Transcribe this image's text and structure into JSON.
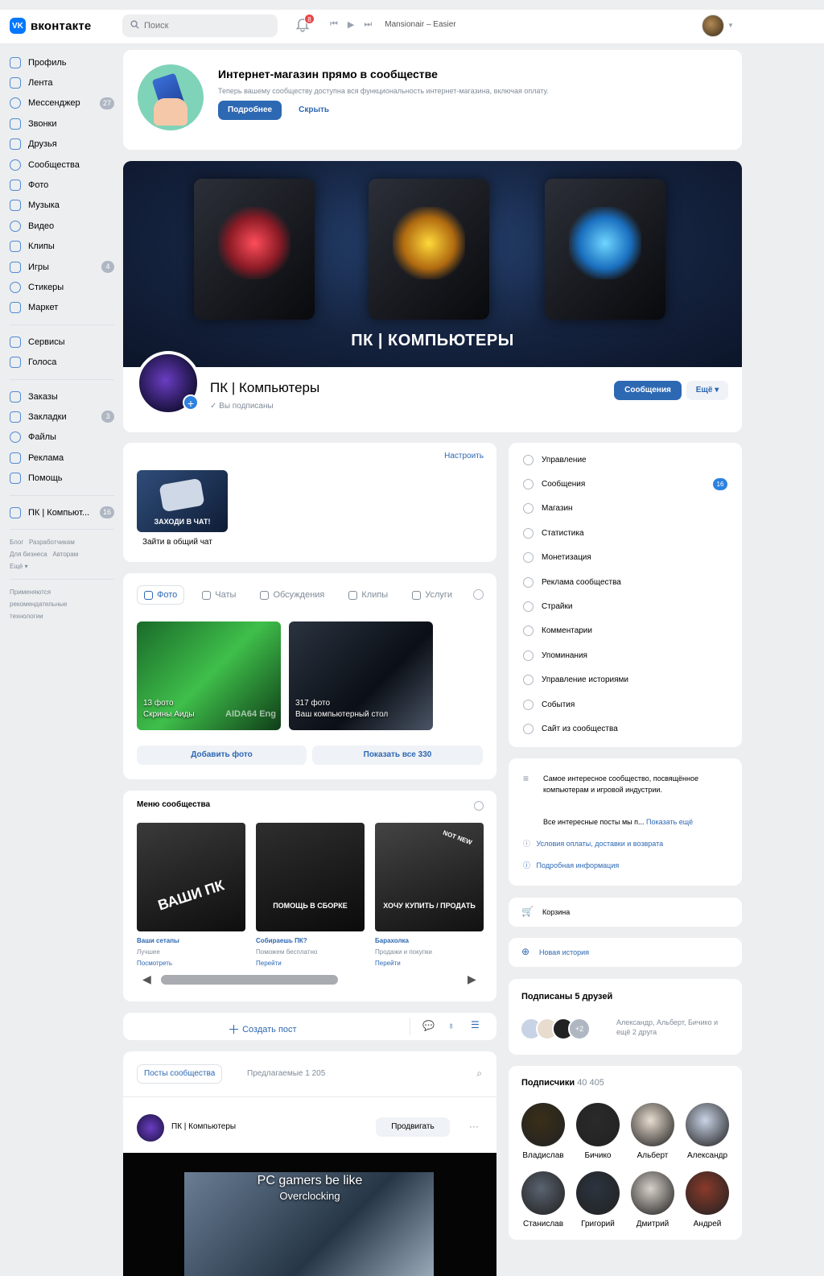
{
  "topbar": {
    "logo_text": "вконтакте",
    "logo_mark": "VK",
    "search_placeholder": "Поиск",
    "notif_count": "8",
    "track": "Mansionair – Easier"
  },
  "sidebar": {
    "items": [
      {
        "label": "Профиль",
        "icon": "profile-icon"
      },
      {
        "label": "Лента",
        "icon": "news-icon"
      },
      {
        "label": "Мессенджер",
        "icon": "messenger-icon",
        "count": "27"
      },
      {
        "label": "Звонки",
        "icon": "calls-icon"
      },
      {
        "label": "Друзья",
        "icon": "friends-icon"
      },
      {
        "label": "Сообщества",
        "icon": "communities-icon"
      },
      {
        "label": "Фото",
        "icon": "photo-icon"
      },
      {
        "label": "Музыка",
        "icon": "music-icon"
      },
      {
        "label": "Видео",
        "icon": "video-icon"
      },
      {
        "label": "Клипы",
        "icon": "clips-icon"
      },
      {
        "label": "Игры",
        "icon": "games-icon",
        "count": "4"
      },
      {
        "label": "Стикеры",
        "icon": "stickers-icon"
      },
      {
        "label": "Маркет",
        "icon": "market-icon"
      }
    ],
    "items2": [
      {
        "label": "Сервисы",
        "icon": "services-icon"
      },
      {
        "label": "Голоса",
        "icon": "votes-icon"
      }
    ],
    "items3": [
      {
        "label": "Заказы",
        "icon": "orders-icon"
      },
      {
        "label": "Закладки",
        "icon": "bookmarks-icon",
        "count": "3"
      },
      {
        "label": "Файлы",
        "icon": "files-icon"
      },
      {
        "label": "Реклама",
        "icon": "ads-icon"
      },
      {
        "label": "Помощь",
        "icon": "help-icon"
      }
    ],
    "items4": [
      {
        "label": "ПК | Компьют...",
        "icon": "community-icon",
        "count": "16"
      }
    ],
    "footer_links": [
      "Блог",
      "Разработчикам",
      "Для бизнеса",
      "Авторам",
      "Ещё"
    ],
    "footer_note": "Применяются рекомендательные технологии"
  },
  "promo": {
    "title": "Интернет-магазин прямо в сообществе",
    "text": "Теперь вашему сообществу доступна вся функциональность интернет-магазина, включая оплату.",
    "more": "Подробнее",
    "hide": "Скрыть"
  },
  "cover": {
    "title": "ПК | КОМПЬЮТЕРЫ"
  },
  "community": {
    "name": "ПК | Компьютеры",
    "status": "Вы подписаны",
    "message_btn": "Сообщения",
    "more_btn": "Ещё"
  },
  "chat": {
    "configure": "Настроить",
    "thumb_text": "ЗАХОДИ В ЧАТ!",
    "label": "Зайти в общий чат"
  },
  "media": {
    "tabs": [
      "Фото",
      "Чаты",
      "Обсуждения",
      "Клипы",
      "Услуги"
    ],
    "albums": [
      {
        "count": "13 фото",
        "title": "Скрины Аиды",
        "watermark": "AIDA64 Eng"
      },
      {
        "count": "317 фото",
        "title": "Ваш компьютерный стол"
      }
    ],
    "add_photo": "Добавить фото",
    "show_all": "Показать все 330"
  },
  "community_menu": {
    "title": "Меню сообщества",
    "tiles": [
      {
        "art": "ВАШИ ПК",
        "title": "Ваши сетапы",
        "sub": "Лучшее",
        "action": "Посмотреть"
      },
      {
        "art": "ПОМОЩЬ В СБОРКЕ",
        "title": "Собираешь ПК?",
        "sub": "Поможем бесплатно",
        "action": "Перейти"
      },
      {
        "art": "ХОЧУ КУПИТЬ / ПРОДАТЬ",
        "art2": "NOT NEW",
        "title": "Барахолка",
        "sub": "Продажи и покупки",
        "action": "Перейти"
      }
    ]
  },
  "create_post": {
    "label": "Создать пост"
  },
  "posts": {
    "tab_community": "Посты сообщества",
    "tab_suggested": "Предлагаемые 1 205",
    "author": "ПК | Компьютеры",
    "promote": "Продвигать",
    "more": "···",
    "video_line1": "PC gamers be like",
    "video_line2": "Overclocking"
  },
  "manage_menu": [
    {
      "label": "Управление",
      "icon": "settings-icon"
    },
    {
      "label": "Сообщения",
      "icon": "messages-icon",
      "count": "16"
    },
    {
      "label": "Магазин",
      "icon": "shop-icon"
    },
    {
      "label": "Статистика",
      "icon": "stats-icon"
    },
    {
      "label": "Монетизация",
      "icon": "monetization-icon"
    },
    {
      "label": "Реклама сообщества",
      "icon": "community-ads-icon"
    },
    {
      "label": "Страйки",
      "icon": "strikes-icon"
    },
    {
      "label": "Комментарии",
      "icon": "comments-icon"
    },
    {
      "label": "Упоминания",
      "icon": "mentions-icon"
    },
    {
      "label": "Управление историями",
      "icon": "stories-icon"
    },
    {
      "label": "События",
      "icon": "events-icon"
    },
    {
      "label": "Сайт из сообщества",
      "icon": "site-icon"
    }
  ],
  "about": {
    "description": "Самое интересное сообщество, посвящённое компьютерам и игровой индустрии.",
    "posts_line": "Все интересные посты мы п...",
    "show_more": "Показать ещё",
    "terms": "Условия оплаты, доставки и возврата",
    "details": "Подробная информация"
  },
  "cart": {
    "label": "Корзина"
  },
  "story": {
    "label": "Новая история"
  },
  "friends": {
    "title": "Подписаны 5 друзей",
    "extra": "+2",
    "names": "Александр, Альберт, Бичико и ещё 2 друга"
  },
  "subscribers": {
    "title": "Подписчики",
    "count": "40 405",
    "people": [
      {
        "name": "Владислав",
        "color": "#3a2f18"
      },
      {
        "name": "Бичико",
        "color": "#2a2a2a"
      },
      {
        "name": "Альберт",
        "color": "#e8dccf"
      },
      {
        "name": "Александр",
        "color": "#c9d3e6"
      },
      {
        "name": "Станислав",
        "color": "#5a6370"
      },
      {
        "name": "Григорий",
        "color": "#2b3440"
      },
      {
        "name": "Дмитрий",
        "color": "#d8d1ca"
      },
      {
        "name": "Андрей",
        "color": "#8a3a2a"
      }
    ]
  },
  "colors": {
    "accent": "#2d68b3",
    "vk_blue": "#0077ff",
    "bg": "#edeef0"
  }
}
